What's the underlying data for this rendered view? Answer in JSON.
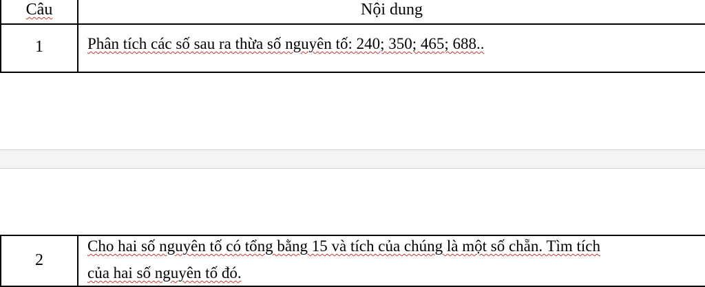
{
  "header": {
    "col_question": "Câu",
    "col_content": "Nội dung"
  },
  "rows": [
    {
      "number": "1",
      "text": "Phân tích các số sau ra thừa số nguyên tố:  240; 350;    465; 688.."
    },
    {
      "number": "2",
      "line1": "Cho hai số nguyên tố có tổng bằng 15 và tích của chúng là một số chẵn. Tìm tích",
      "line2": "của hai số nguyên tố đó."
    }
  ]
}
